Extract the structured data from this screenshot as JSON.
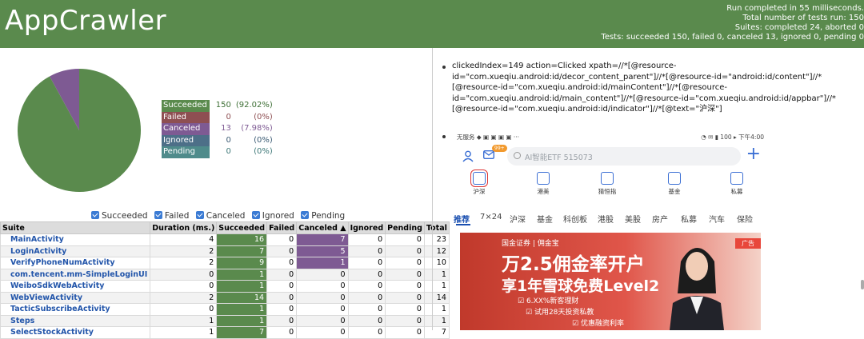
{
  "header": {
    "title": "AppCrawler",
    "summary_lines": [
      "Run completed in 55 milliseconds.",
      "Total number of tests run: 150",
      "Suites: completed 24, aborted 0",
      "Tests: succeeded 150, failed 0, canceled 13, ignored 0, pending 0"
    ]
  },
  "chart_data": {
    "type": "pie",
    "categories": [
      "Succeeded",
      "Failed",
      "Canceled",
      "Ignored",
      "Pending"
    ],
    "values": [
      150,
      0,
      13,
      0,
      0
    ],
    "colors": [
      "#5a8a4d",
      "#8e4f52",
      "#7e5a93",
      "#4d6f88",
      "#4f8b8b"
    ]
  },
  "legend": [
    {
      "label": "Succeeded",
      "count": "150",
      "pct": "(92.02%)"
    },
    {
      "label": "Failed",
      "count": "0",
      "pct": "(0%)"
    },
    {
      "label": "Canceled",
      "count": "13",
      "pct": "(7.98%)"
    },
    {
      "label": "Ignored",
      "count": "0",
      "pct": "(0%)"
    },
    {
      "label": "Pending",
      "count": "0",
      "pct": "(0%)"
    }
  ],
  "filters": [
    "Succeeded",
    "Failed",
    "Canceled",
    "Ignored",
    "Pending"
  ],
  "table": {
    "headers": [
      "Suite",
      "Duration (ms.)",
      "Succeeded",
      "Failed",
      "Canceled ▲",
      "Ignored",
      "Pending",
      "Total"
    ],
    "rows": [
      [
        "MainActivity",
        "4",
        "16",
        "0",
        "7",
        "0",
        "0",
        "23"
      ],
      [
        "LoginActivity",
        "2",
        "7",
        "0",
        "5",
        "0",
        "0",
        "12"
      ],
      [
        "VerifyPhoneNumActivity",
        "2",
        "9",
        "0",
        "1",
        "0",
        "0",
        "10"
      ],
      [
        "com.tencent.mm-SimpleLoginUI",
        "0",
        "1",
        "0",
        "0",
        "0",
        "0",
        "1"
      ],
      [
        "WeiboSdkWebActivity",
        "0",
        "1",
        "0",
        "0",
        "0",
        "0",
        "1"
      ],
      [
        "WebViewActivity",
        "2",
        "14",
        "0",
        "0",
        "0",
        "0",
        "14"
      ],
      [
        "TacticSubscribeActivity",
        "0",
        "1",
        "0",
        "0",
        "0",
        "0",
        "1"
      ],
      [
        "Steps",
        "1",
        "1",
        "0",
        "0",
        "0",
        "0",
        "1"
      ],
      [
        "SelectStockActivity",
        "1",
        "7",
        "0",
        "0",
        "0",
        "0",
        "7"
      ]
    ]
  },
  "detail": {
    "text": "clickedIndex=149 action=Clicked xpath=//*[@resource-id=\"com.xueqiu.android:id/decor_content_parent\"]//*[@resource-id=\"android:id/content\"]//*[@resource-id=\"com.xueqiu.android:id/mainContent\"]//*[@resource-id=\"com.xueqiu.android:id/main_content\"]//*[@resource-id=\"com.xueqiu.android:id/appbar\"]//*[@resource-id=\"com.xueqiu.android:id/indicator\"]//*[@text=\"沪深\"]"
  },
  "phone": {
    "status_left": "无服务 ◆ ▣ ▣ ▣ ▣ ···",
    "status_right": "◔ ✉ ▮ 100 ▸ 下午4:00",
    "badge": "99+",
    "search_placeholder": "AI智能ETF 515073",
    "quick_items": [
      "沪深",
      "港美",
      "猜恒指",
      "基金",
      "私募"
    ],
    "tabs": [
      "推荐",
      "7×24",
      "沪深",
      "基金",
      "科创板",
      "港股",
      "美股",
      "房产",
      "私募",
      "汽车",
      "保险"
    ],
    "banner": {
      "brand": "国金证券 | 佣金宝",
      "ad": "广告",
      "headline": "万2.5佣金率开户",
      "subline": "享1年雪球免费Level2",
      "bullet1": "6.XX%新客理财",
      "bullet2": "试用28天投资私教",
      "bullet3": "优惠融资利率"
    }
  }
}
